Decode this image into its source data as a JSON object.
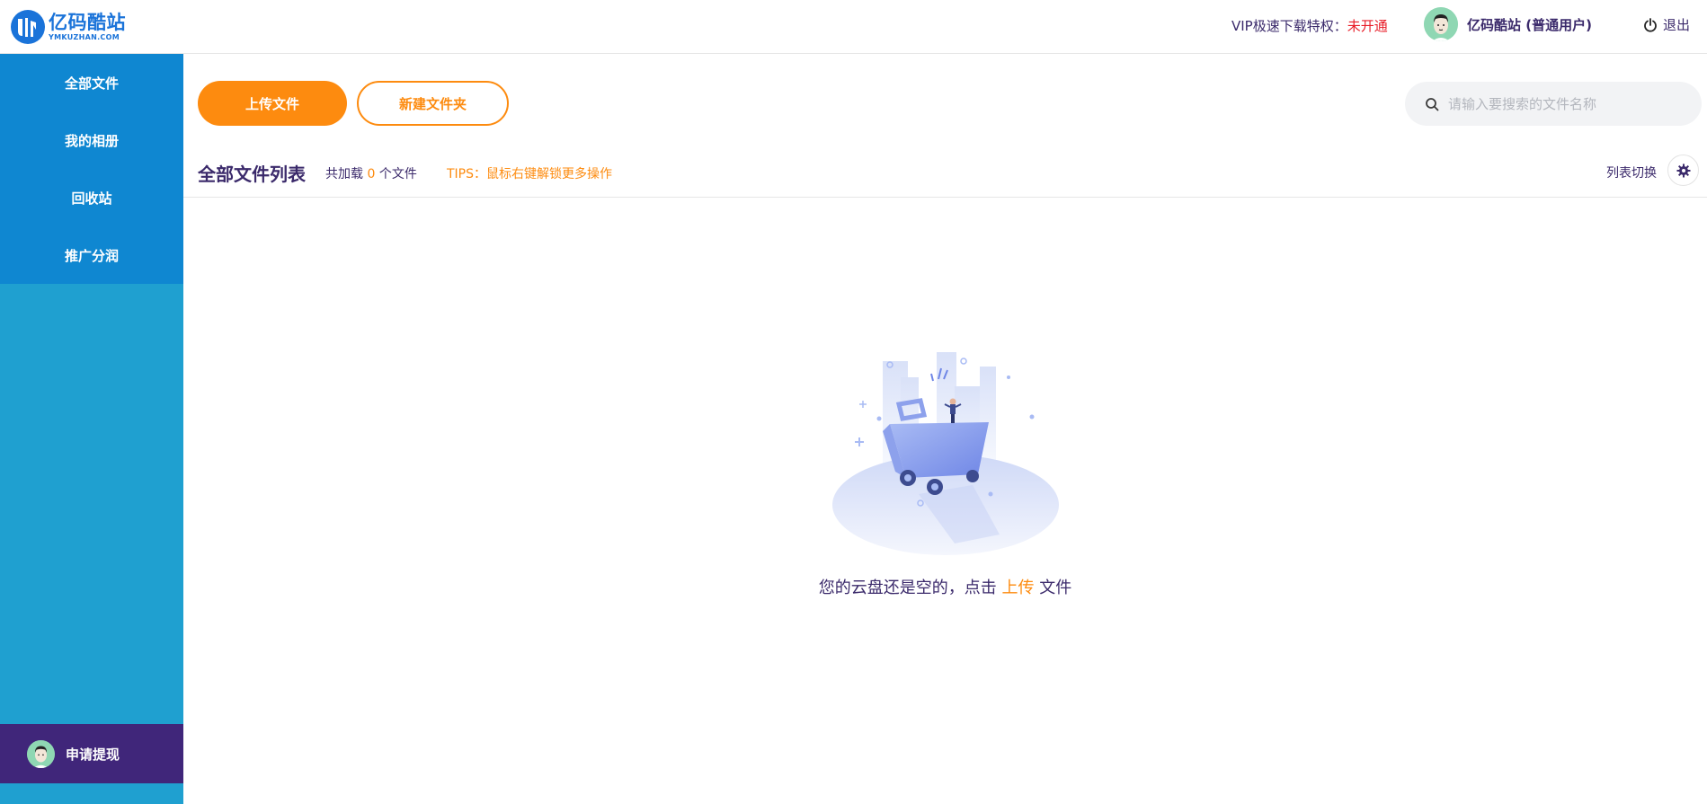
{
  "header": {
    "logo_cn": "亿码酷站",
    "logo_en": "YMKUZHAN.COM",
    "vip_label": "VIP极速下载特权：",
    "vip_status": "未开通",
    "user_name": "亿码酷站 (普通用户)",
    "logout_label": "退出"
  },
  "sidebar": {
    "items": [
      {
        "label": "全部文件"
      },
      {
        "label": "我的相册"
      },
      {
        "label": "回收站"
      },
      {
        "label": "推广分润"
      }
    ],
    "withdraw_label": "申请提现"
  },
  "toolbar": {
    "upload_label": "上传文件",
    "new_folder_label": "新建文件夹",
    "search_placeholder": "请输入要搜索的文件名称"
  },
  "list": {
    "title": "全部文件列表",
    "count_prefix": "共加载",
    "count_value": "0",
    "count_suffix": "个文件",
    "tips": "TIPS：鼠标右键解锁更多操作",
    "view_toggle_label": "列表切换"
  },
  "empty_state": {
    "text_before": "您的云盘还是空的，点击",
    "link": "上传",
    "text_after": "文件"
  },
  "colors": {
    "accent": "#fd8b0f",
    "nav_bg": "#0f87d1",
    "sidebar_bg": "#1fa0d0",
    "withdraw_bg": "#40267a",
    "text": "#3b2a6b",
    "vip_status": "#e81c27"
  },
  "icons": [
    "logo-icon",
    "avatar-icon",
    "power-icon",
    "search-icon",
    "gear-icon",
    "empty-cart-illustration"
  ]
}
